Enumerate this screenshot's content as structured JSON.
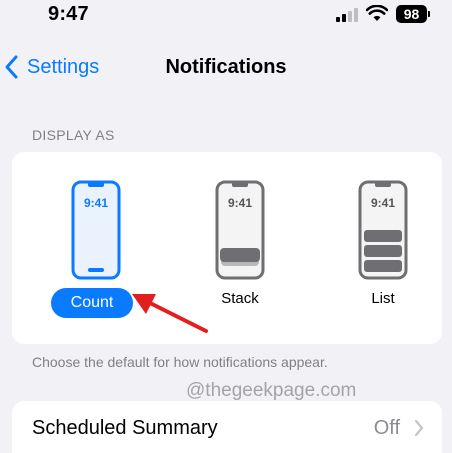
{
  "status_bar": {
    "time": "9:47",
    "battery": "98"
  },
  "nav": {
    "back_label": "Settings",
    "title": "Notifications"
  },
  "display_as": {
    "header": "DISPLAY AS",
    "options": [
      {
        "label": "Count",
        "time": "9:41",
        "selected": true
      },
      {
        "label": "Stack",
        "time": "9:41",
        "selected": false
      },
      {
        "label": "List",
        "time": "9:41",
        "selected": false
      }
    ],
    "footer": "Choose the default for how notifications appear."
  },
  "watermark": "@thegeekpage.com",
  "scheduled_summary": {
    "label": "Scheduled Summary",
    "value": "Off"
  },
  "colors": {
    "accent": "#0a7aff",
    "annotation_arrow": "#e31e1e",
    "background": "#f2f2f6"
  }
}
